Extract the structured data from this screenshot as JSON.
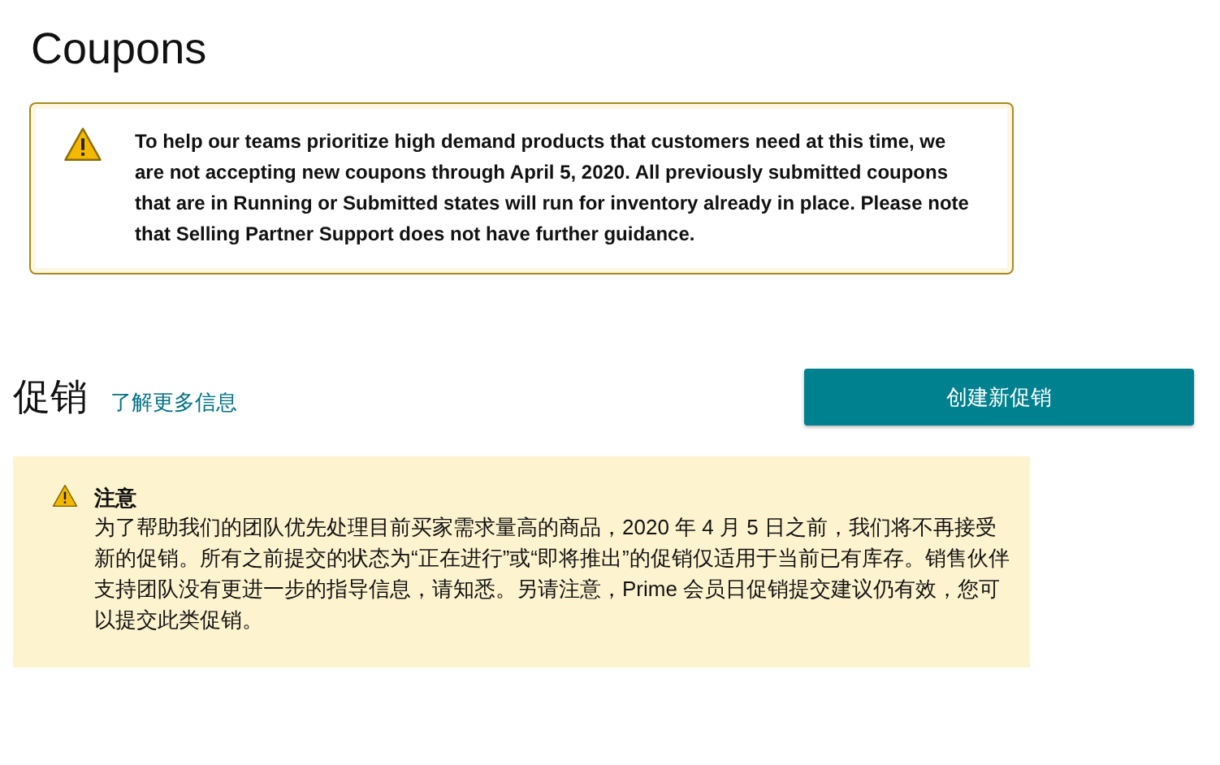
{
  "page_title": "Coupons",
  "coupon_alert": {
    "text": "To help our teams prioritize high demand products that customers need at this time, we are not accepting new coupons through April 5, 2020. All previously submitted coupons that are in Running or Submitted states will run for inventory already in place. Please note that Selling Partner Support does not have further guidance."
  },
  "promotions": {
    "title": "促销",
    "learn_more_link": "了解更多信息",
    "create_button": "创建新促销"
  },
  "notice": {
    "title": "注意",
    "text": "为了帮助我们的团队优先处理目前买家需求量高的商品，2020 年 4 月 5 日之前，我们将不再接受新的促销。所有之前提交的状态为“正在进行”或“即将推出”的促销仅适用于当前已有库存。销售伙伴支持团队没有更进一步的指导信息，请知悉。另请注意，Prime 会员日促销提交建议仍有效，您可以提交此类促销。"
  }
}
